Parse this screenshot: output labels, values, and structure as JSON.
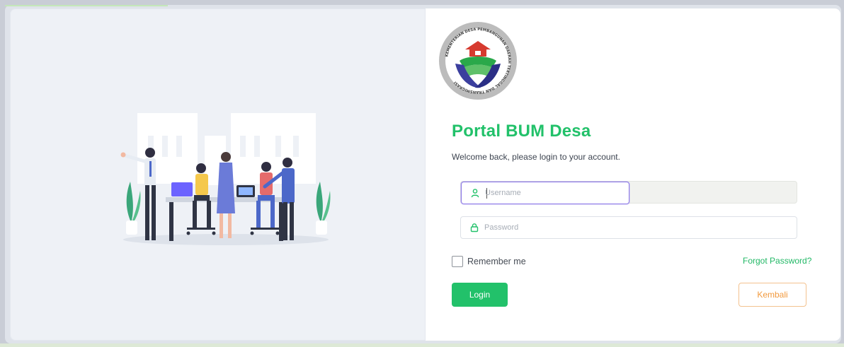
{
  "app": {
    "title": "Portal BUM Desa",
    "subtitle": "Welcome back, please login to your account."
  },
  "logo": {
    "icon": "ministry-emblem-icon",
    "text": "KEMENTERIAN DESA PEMBANGUNAN DAERAH TERTINGGAL DAN TRANSMIGRASI"
  },
  "form": {
    "username": {
      "placeholder": "Username",
      "value": "",
      "icon": "user-icon"
    },
    "password": {
      "placeholder": "Password",
      "value": "",
      "icon": "lock-icon"
    },
    "remember_label": "Remember me",
    "forgot_label": "Forgot Password?",
    "login_label": "Login",
    "back_label": "Kembali"
  },
  "colors": {
    "brand_green": "#22c16a",
    "back_orange": "#f29a3e",
    "focus_purple": "#8d79e8"
  }
}
